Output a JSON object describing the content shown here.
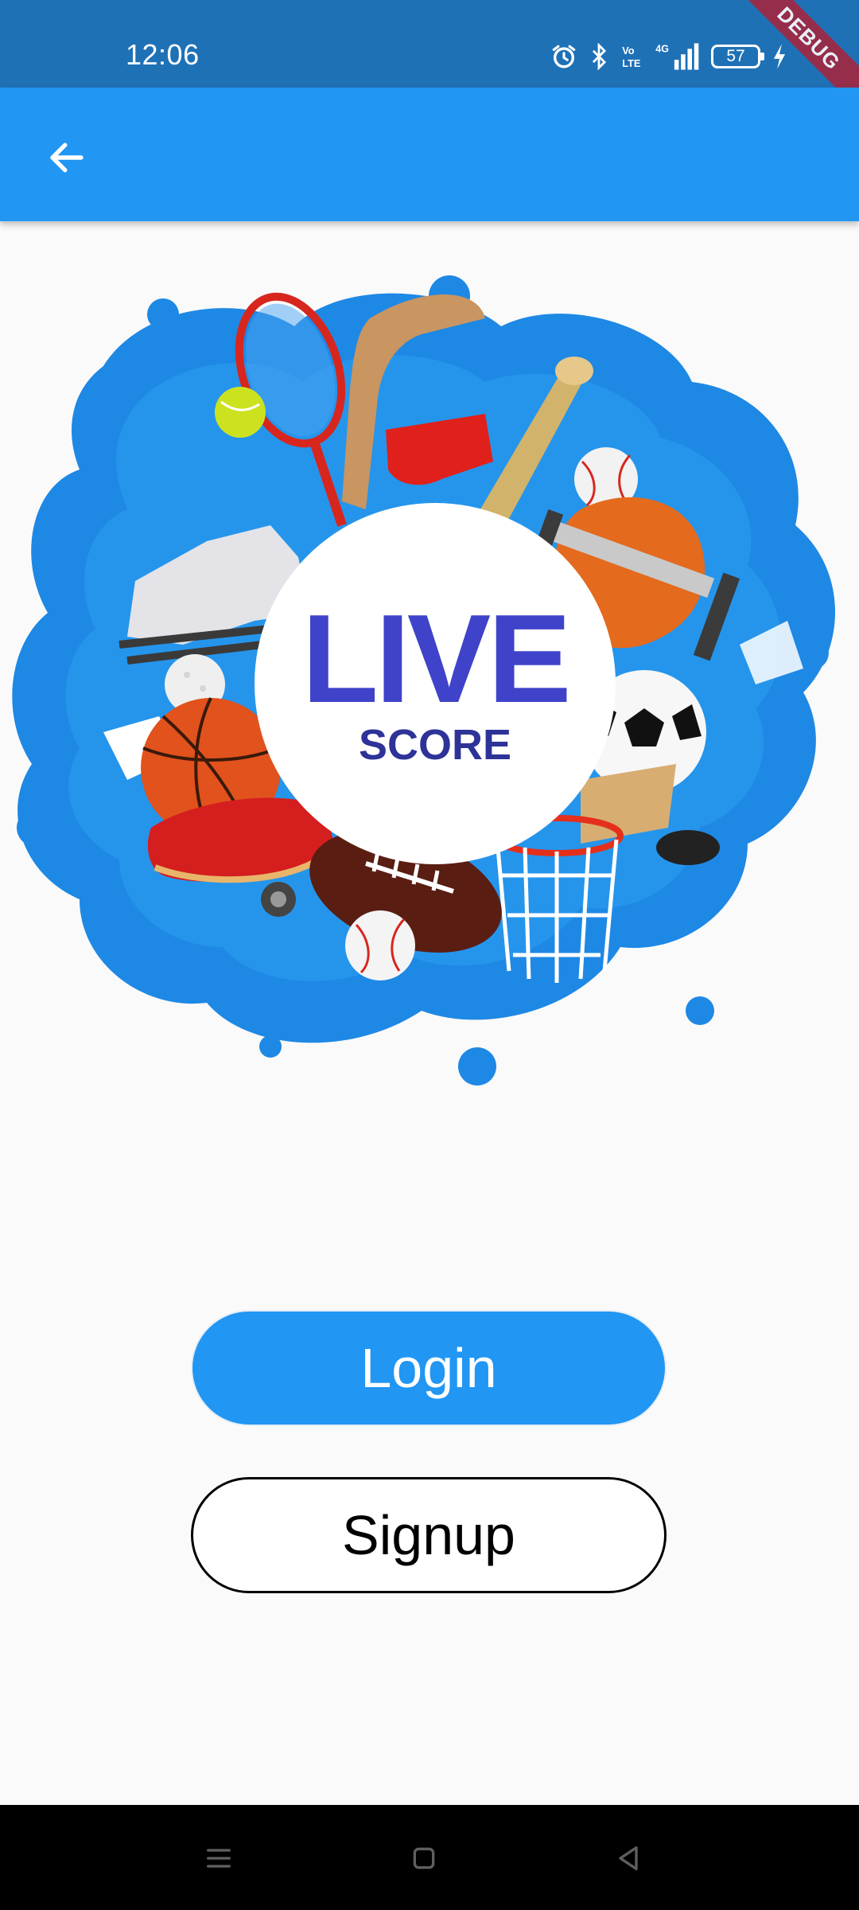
{
  "status_bar": {
    "time": "12:06",
    "battery_level": "57",
    "network_label": "4G",
    "volte_label": "Vo LTE",
    "icons": [
      "alarm-icon",
      "bluetooth-icon",
      "volte-icon",
      "signal-icon",
      "battery-icon",
      "charging-icon"
    ]
  },
  "debug_banner": {
    "label": "DEBUG"
  },
  "app_bar": {
    "back_icon": "arrow-back-icon",
    "color": "#2196f3"
  },
  "hero": {
    "logo_line1": "LIVE",
    "logo_line2": "SCORE"
  },
  "actions": {
    "login_label": "Login",
    "signup_label": "Signup"
  },
  "nav_bar": {
    "icons": [
      "menu-icon",
      "home-icon",
      "back-icon"
    ]
  },
  "colors": {
    "primary": "#2196f3",
    "status_bar": "#1f71b6",
    "logo_text": "#3f43c9",
    "background": "#fafafa"
  }
}
